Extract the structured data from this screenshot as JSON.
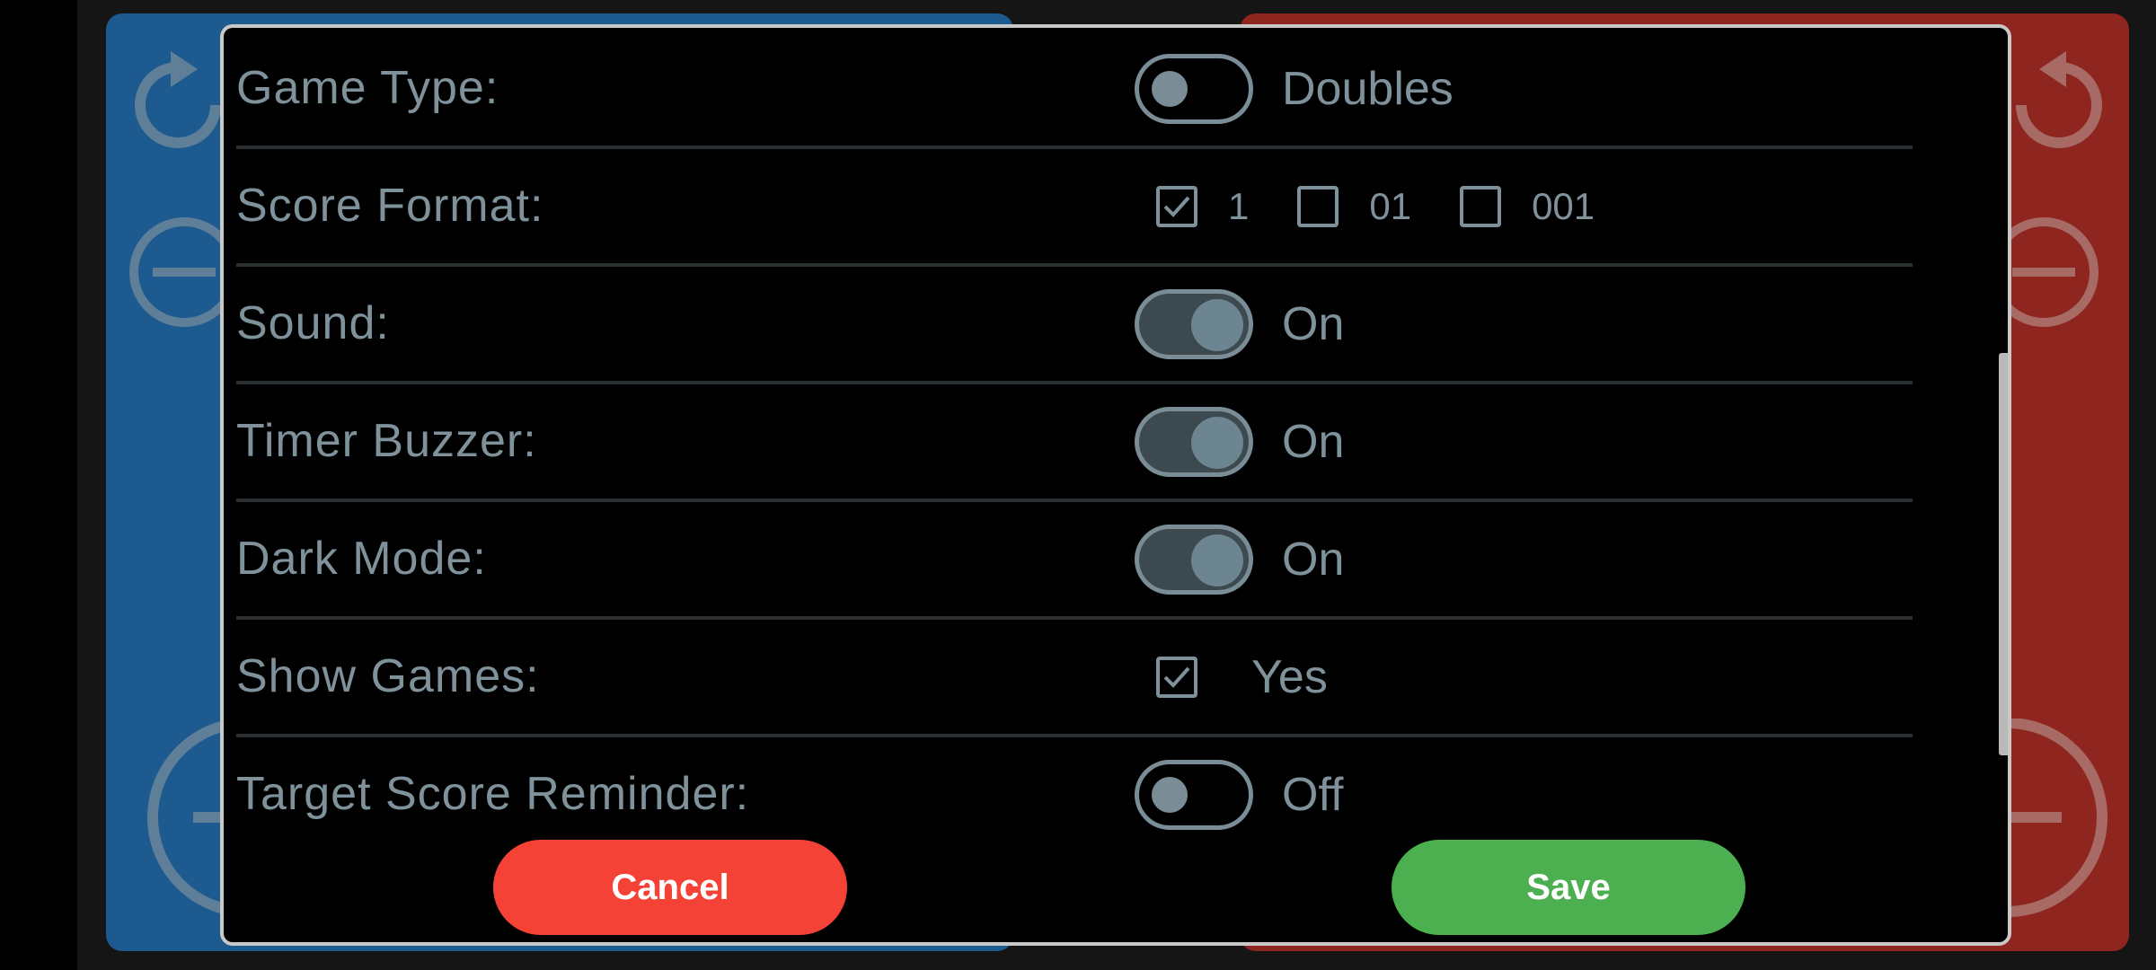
{
  "settings": {
    "game_type": {
      "label": "Game Type:",
      "state": "Doubles",
      "on": false
    },
    "score_format": {
      "label": "Score Format:",
      "options": [
        {
          "text": "1",
          "checked": true
        },
        {
          "text": "01",
          "checked": false
        },
        {
          "text": "001",
          "checked": false
        }
      ]
    },
    "sound": {
      "label": "Sound:",
      "state": "On",
      "on": true
    },
    "timer_buzzer": {
      "label": "Timer Buzzer:",
      "state": "On",
      "on": true
    },
    "dark_mode": {
      "label": "Dark Mode:",
      "state": "On",
      "on": true
    },
    "show_games": {
      "label": "Show Games:",
      "state": "Yes",
      "checked": true
    },
    "target_score_reminder": {
      "label": "Target Score Reminder:",
      "state": "Off",
      "on": false
    }
  },
  "buttons": {
    "cancel": "Cancel",
    "save": "Save"
  },
  "colors": {
    "team_left": "#1d5a8f",
    "team_right": "#8e261f",
    "cancel": "#f44336",
    "save": "#4caf50"
  },
  "icons": [
    "undo-icon",
    "minus-circle-icon"
  ]
}
